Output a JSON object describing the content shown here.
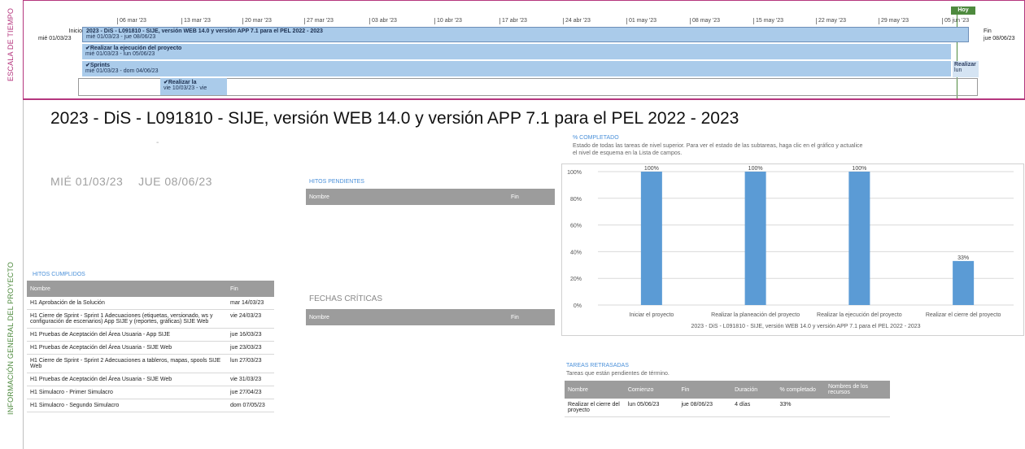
{
  "side": {
    "timescale_label": "ESCALA DE TIEMPO",
    "project_info_label": "INFORMACIÓN GENERAL DEL PROYECTO"
  },
  "timeline": {
    "start_label": "Inicio",
    "start_date": "mié 01/03/23",
    "end_label": "Fin",
    "end_date": "jue 08/06/23",
    "today_label": "Hoy",
    "ticks": [
      "06 mar '23",
      "13 mar '23",
      "20 mar '23",
      "27 mar '23",
      "03 abr '23",
      "10 abr '23",
      "17 abr '23",
      "24 abr '23",
      "01 may '23",
      "08 may '23",
      "15 may '23",
      "22 may '23",
      "29 may '23",
      "05 jun '23"
    ],
    "bars": [
      {
        "title": "2023 - DiS - L091810 - SIJE, versión WEB 14.0 y versión APP 7.1 para el PEL 2022 - 2023",
        "dates": "mié 01/03/23 - jue 08/06/23"
      },
      {
        "title": "✔Realizar la ejecución del proyecto",
        "dates": "mié 01/03/23 - lun 05/06/23"
      },
      {
        "title": "✔Sprints",
        "dates": "mié 01/03/23 - dom 04/06/23"
      },
      {
        "title": "✔Realizar la",
        "dates": "vie 10/03/23 - vie"
      }
    ],
    "right_stub": {
      "title": "Realizar",
      "dates": "lun"
    }
  },
  "main": {
    "title": "2023 - DiS - L091810 - SIJE, versión WEB 14.0 y versión APP 7.1 para el PEL 2022 - 2023",
    "dash": "-",
    "start_date": "MIÉ 01/03/23",
    "end_date": "JUE 08/06/23"
  },
  "hitos_pendientes": {
    "title": "HITOS PENDIENTES",
    "col_name": "Nombre",
    "col_end": "Fin"
  },
  "fechas_criticas": {
    "title": "FECHAS CRÍTICAS",
    "col_name": "Nombre",
    "col_end": "Fin"
  },
  "hitos_cumplidos": {
    "title": "HITOS CUMPLIDOS",
    "col_name": "Nombre",
    "col_end": "Fin",
    "rows": [
      {
        "name": "H1 Aprobación de la Solución",
        "end": "mar 14/03/23"
      },
      {
        "name": "H1 Cierre de Sprint - Sprint 1 Adecuaciones (etiquetas, versionado, ws y configuración de escenarios) App SIJE y (reportes, gráficas) SIJE Web",
        "end": "vie 24/03/23"
      },
      {
        "name": "H1 Pruebas de Aceptación del Área Usuaria - App SIJE",
        "end": "jue 16/03/23"
      },
      {
        "name": "H1 Pruebas de Aceptación del Área Usuaria - SIJE Web",
        "end": "jue 23/03/23"
      },
      {
        "name": "H1 Cierre de Sprint - Sprint 2 Adecuaciones a tableros, mapas, spools SIJE Web",
        "end": "lun 27/03/23"
      },
      {
        "name": "H1 Pruebas de Aceptación del Área Usuaria - SIJE Web",
        "end": "vie 31/03/23"
      },
      {
        "name": "H1 Simulacro - Primer Simulacro",
        "end": "jue 27/04/23"
      },
      {
        "name": "H1 Simulacro - Segundo Simulacro",
        "end": "dom 07/05/23"
      }
    ]
  },
  "completado": {
    "title": "% COMPLETADO",
    "description": "Estado de todas las tareas de nivel superior. Para ver el estado de las subtareas, haga clic en el gráfico y actualice el nivel de esquema en la Lista de campos."
  },
  "chart_data": {
    "type": "bar",
    "categories": [
      "Iniciar el proyecto",
      "Realizar la planeación del proyecto",
      "Realizar la ejecución del proyecto",
      "Realizar el cierre del proyecto"
    ],
    "values": [
      1.0,
      1.0,
      1.0,
      0.33
    ],
    "value_labels": [
      "100%",
      "100%",
      "100%",
      "33%"
    ],
    "yticks": [
      "0%",
      "20%",
      "40%",
      "60%",
      "80%",
      "100%"
    ],
    "ylim": [
      0,
      1
    ],
    "xlabel": "2023 - DiS - L091810 - SIJE, versión WEB 14.0 y versión APP 7.1 para el PEL 2022 - 2023",
    "bar_color": "#5b9bd5",
    "grid": true
  },
  "tareas_retrasadas": {
    "title": "TAREAS RETRASADAS",
    "subtitle": "Tareas que están pendientes de término.",
    "headers": [
      "Nombre",
      "Comienzo",
      "Fin",
      "Duración",
      "% completado",
      "Nombres de los recursos"
    ],
    "rows": [
      [
        "Realizar el cierre del proyecto",
        "lun 05/06/23",
        "jue 08/06/23",
        "4 días",
        "33%",
        ""
      ]
    ]
  },
  "colors": {
    "accent_magenta": "#b5367e",
    "accent_green": "#4e8a3e",
    "bar_light_blue": "#aacbea",
    "header_grey": "#9c9c9c"
  }
}
